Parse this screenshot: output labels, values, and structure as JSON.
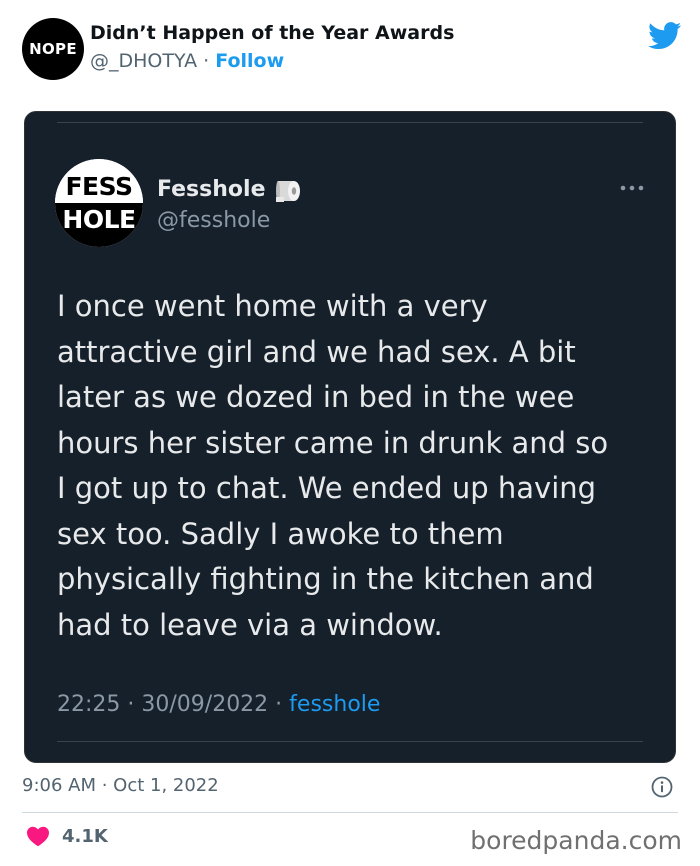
{
  "outer": {
    "avatar_text": "NOPE",
    "display_name": "Didn’t Happen of the Year Awards",
    "handle": "@_DHOTYA",
    "separator": " · ",
    "follow_label": "Follow",
    "timestamp": "9:06 AM · Oct 1, 2022",
    "likes": "4.1K"
  },
  "embedded": {
    "avatar_top": "FESS",
    "avatar_bottom": "HOLE",
    "display_name": "Fesshole",
    "handle": "@fesshole",
    "text": "I once went home with a very\nattractive girl and we had sex. A bit\nlater as we dozed in bed in the wee\nhours her sister came in drunk and so\nI got up to chat. We ended up having\nsex too. Sadly I awoke to them\nphysically fighting in the kitchen and\nhad to leave via a window.",
    "time_date": "22:25 · 30/09/2022",
    "separator": " · ",
    "source": "fesshole"
  },
  "watermark": "boredpanda.com",
  "icons": {
    "brand": "twitter-bird-icon",
    "more": "more-horizontal-icon",
    "info": "info-icon",
    "like": "heart-icon",
    "name_emoji": "toilet-paper-icon"
  },
  "colors": {
    "twitter_blue": "#1d9bf0",
    "like_pink": "#f91880",
    "embed_background": "#15202b"
  }
}
